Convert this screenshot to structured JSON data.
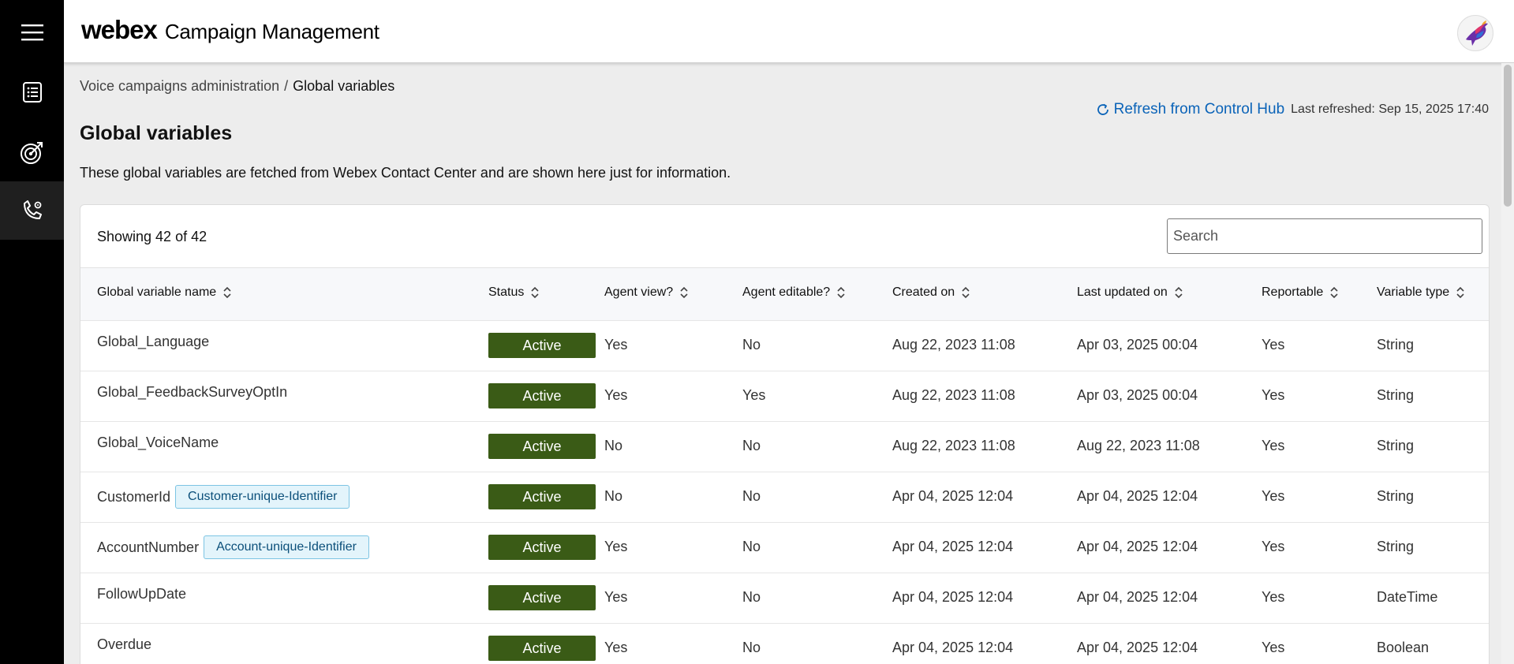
{
  "app": {
    "logo": "webex",
    "title": "Campaign Management"
  },
  "rail": {
    "items": [
      {
        "icon": "hamburger-menu-icon"
      },
      {
        "icon": "list-icon"
      },
      {
        "icon": "target-icon"
      },
      {
        "icon": "phone-settings-icon",
        "active": true
      }
    ]
  },
  "breadcrumb": {
    "parent": "Voice campaigns administration",
    "separator": "/",
    "current": "Global variables"
  },
  "refresh": {
    "label": "Refresh from Control Hub",
    "last_refreshed": "Last refreshed: Sep 15, 2025 17:40"
  },
  "page": {
    "title": "Global variables",
    "description": "These global variables are fetched from Webex Contact Center and are shown here just for information."
  },
  "table": {
    "showing": "Showing 42 of 42",
    "search_placeholder": "Search",
    "columns": [
      "Global variable name",
      "Status",
      "Agent view?",
      "Agent editable?",
      "Created on",
      "Last updated on",
      "Reportable",
      "Variable type"
    ],
    "rows": [
      {
        "name": "Global_Language",
        "tag": "",
        "status": "Active",
        "agent_view": "Yes",
        "agent_editable": "No",
        "created": "Aug 22, 2023 11:08",
        "updated": "Apr 03, 2025 00:04",
        "reportable": "Yes",
        "type": "String"
      },
      {
        "name": "Global_FeedbackSurveyOptIn",
        "tag": "",
        "status": "Active",
        "agent_view": "Yes",
        "agent_editable": "Yes",
        "created": "Aug 22, 2023 11:08",
        "updated": "Apr 03, 2025 00:04",
        "reportable": "Yes",
        "type": "String"
      },
      {
        "name": "Global_VoiceName",
        "tag": "",
        "status": "Active",
        "agent_view": "No",
        "agent_editable": "No",
        "created": "Aug 22, 2023 11:08",
        "updated": "Aug 22, 2023 11:08",
        "reportable": "Yes",
        "type": "String"
      },
      {
        "name": "CustomerId",
        "tag": "Customer-unique-Identifier",
        "status": "Active",
        "agent_view": "No",
        "agent_editable": "No",
        "created": "Apr 04, 2025 12:04",
        "updated": "Apr 04, 2025 12:04",
        "reportable": "Yes",
        "type": "String"
      },
      {
        "name": "AccountNumber",
        "tag": "Account-unique-Identifier",
        "status": "Active",
        "agent_view": "Yes",
        "agent_editable": "No",
        "created": "Apr 04, 2025 12:04",
        "updated": "Apr 04, 2025 12:04",
        "reportable": "Yes",
        "type": "String"
      },
      {
        "name": "FollowUpDate",
        "tag": "",
        "status": "Active",
        "agent_view": "Yes",
        "agent_editable": "No",
        "created": "Apr 04, 2025 12:04",
        "updated": "Apr 04, 2025 12:04",
        "reportable": "Yes",
        "type": "DateTime"
      },
      {
        "name": "Overdue",
        "tag": "",
        "status": "Active",
        "agent_view": "Yes",
        "agent_editable": "No",
        "created": "Apr 04, 2025 12:04",
        "updated": "Apr 04, 2025 12:04",
        "reportable": "Yes",
        "type": "Boolean"
      }
    ]
  },
  "colors": {
    "status_active": "#3a5b16",
    "link": "#0a63b8",
    "tag_bg": "#e3f4fb",
    "tag_border": "#7cc4e3"
  }
}
